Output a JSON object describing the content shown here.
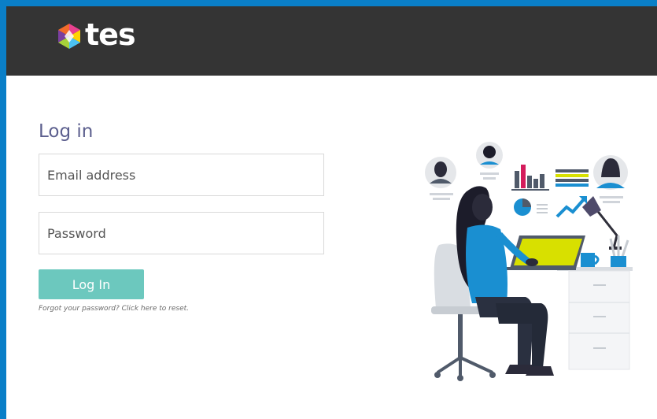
{
  "brand": {
    "name": "tes",
    "colors": {
      "header_bg": "#343434",
      "page_frame": "#0a7fc8",
      "title": "#5c5f8e",
      "button": "#6cc8be"
    }
  },
  "login": {
    "title": "Log in",
    "email_placeholder": "Email address",
    "password_placeholder": "Password",
    "button_label": "Log In",
    "forgot_text": "Forgot your password? Click here to reset."
  },
  "illustration": {
    "icon": "woman-at-desk-illustration"
  }
}
